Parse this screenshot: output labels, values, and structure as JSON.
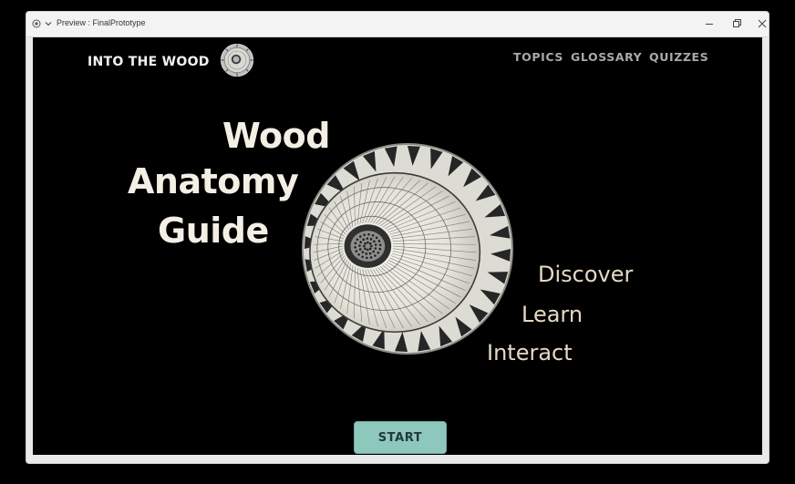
{
  "window": {
    "title": "Preview : FinalPrototype"
  },
  "header": {
    "brand": "INTO THE WOOD",
    "logo_icon": "wood-cross-section-icon",
    "nav": [
      {
        "label": "TOPICS"
      },
      {
        "label": "GLOSSARY"
      },
      {
        "label": "QUIZZES"
      }
    ]
  },
  "hero": {
    "title_lines": [
      "Wood",
      "Anatomy",
      "Guide"
    ],
    "image_icon": "wood-cross-section-icon",
    "taglines": [
      "Discover",
      "Learn",
      "Interact"
    ]
  },
  "start_button": {
    "label": "START"
  },
  "colors": {
    "background": "#000000",
    "title_text": "#f4efe4",
    "tagline_text": "#e6d8c4",
    "nav_text": "#a9a9a9",
    "start_button_bg": "#8ec8bd",
    "start_button_text": "#1e3b37"
  }
}
